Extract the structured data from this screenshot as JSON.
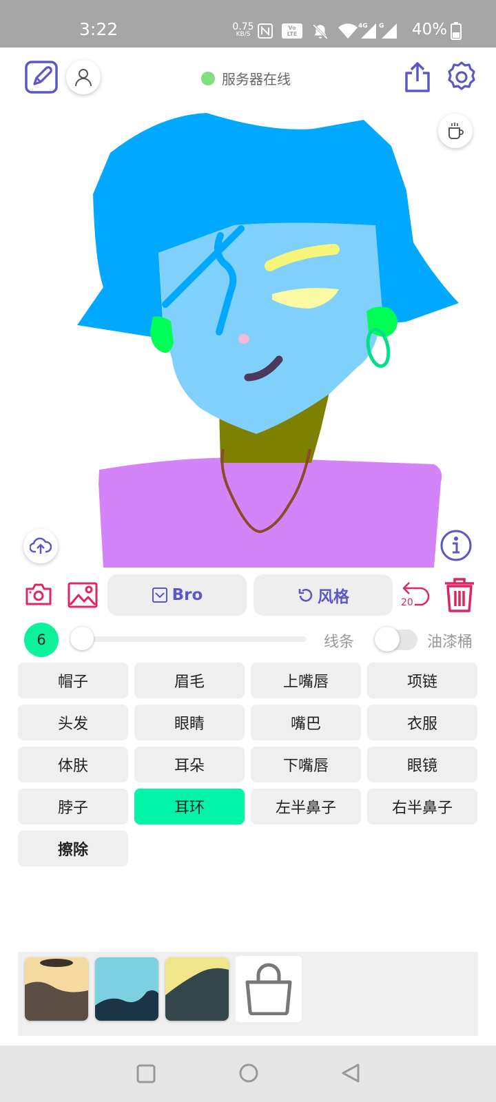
{
  "status_bar": {
    "time": "3:22",
    "net_speed_value": "0.75",
    "net_speed_unit": "KB/S",
    "battery": "40%",
    "icons": [
      "nfc-icon",
      "volte-icon",
      "mute-icon",
      "wifi-icon",
      "signal-4g-icon",
      "signal-g-icon",
      "battery-icon"
    ]
  },
  "top_bar": {
    "server_status": "服务器在线",
    "server_status_color": "#7ee07e",
    "icons": [
      "edit-icon",
      "user-icon",
      "share-icon",
      "settings-icon",
      "coffee-icon"
    ]
  },
  "canvas": {
    "icons": [
      "upload-icon",
      "info-icon"
    ]
  },
  "toolbar": {
    "bro_label": "Bro",
    "style_label": "风格",
    "undo_count": "20",
    "accent_color": "#5b57c4",
    "danger_color": "#e0245e",
    "icons": [
      "camera-icon",
      "image-icon",
      "checkbox-icon",
      "refresh-icon",
      "undo-icon",
      "trash-icon"
    ]
  },
  "brush": {
    "size": "6",
    "size_fraction": 0.0,
    "line_label": "线条",
    "bucket_label": "油漆桶",
    "bucket_enabled": false
  },
  "parts": [
    {
      "label": "帽子"
    },
    {
      "label": "眉毛"
    },
    {
      "label": "上嘴唇"
    },
    {
      "label": "项链"
    },
    {
      "label": "头发"
    },
    {
      "label": "眼睛"
    },
    {
      "label": "嘴巴"
    },
    {
      "label": "衣服"
    },
    {
      "label": "体肤"
    },
    {
      "label": "耳朵"
    },
    {
      "label": "下嘴唇"
    },
    {
      "label": "眼镜"
    },
    {
      "label": "脖子"
    },
    {
      "label": "耳环",
      "active": true
    },
    {
      "label": "左半鼻子"
    },
    {
      "label": "右半鼻子"
    },
    {
      "label": "擦除",
      "bold": true
    }
  ],
  "results": {
    "icons": [
      "bag-icon"
    ]
  }
}
